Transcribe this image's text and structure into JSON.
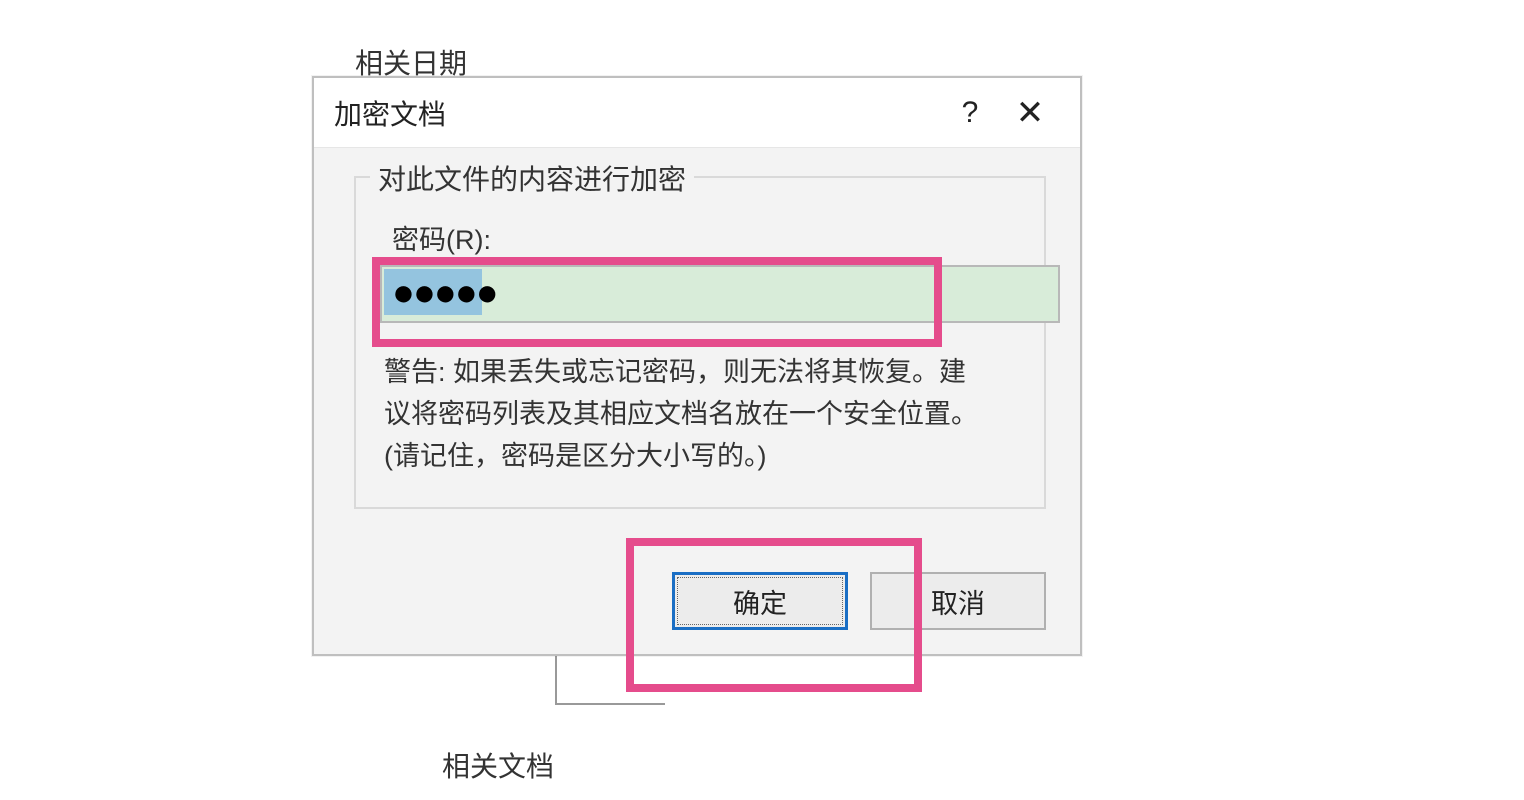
{
  "background": {
    "topText": "相关日期",
    "bottomText": "相关文档"
  },
  "dialog": {
    "title": "加密文档",
    "helpIcon": "?",
    "closeIcon": "✕",
    "fieldsetLegend": "对此文件的内容进行加密",
    "passwordLabel": "密码(R):",
    "passwordMask": "●●●●●",
    "warningLine1": "警告: 如果丢失或忘记密码，则无法将其恢复。建",
    "warningLine2": "议将密码列表及其相应文档名放在一个安全位置。",
    "warningLine3": "(请记住，密码是区分大小写的。)",
    "okButton": "确定",
    "cancelButton": "取消"
  }
}
